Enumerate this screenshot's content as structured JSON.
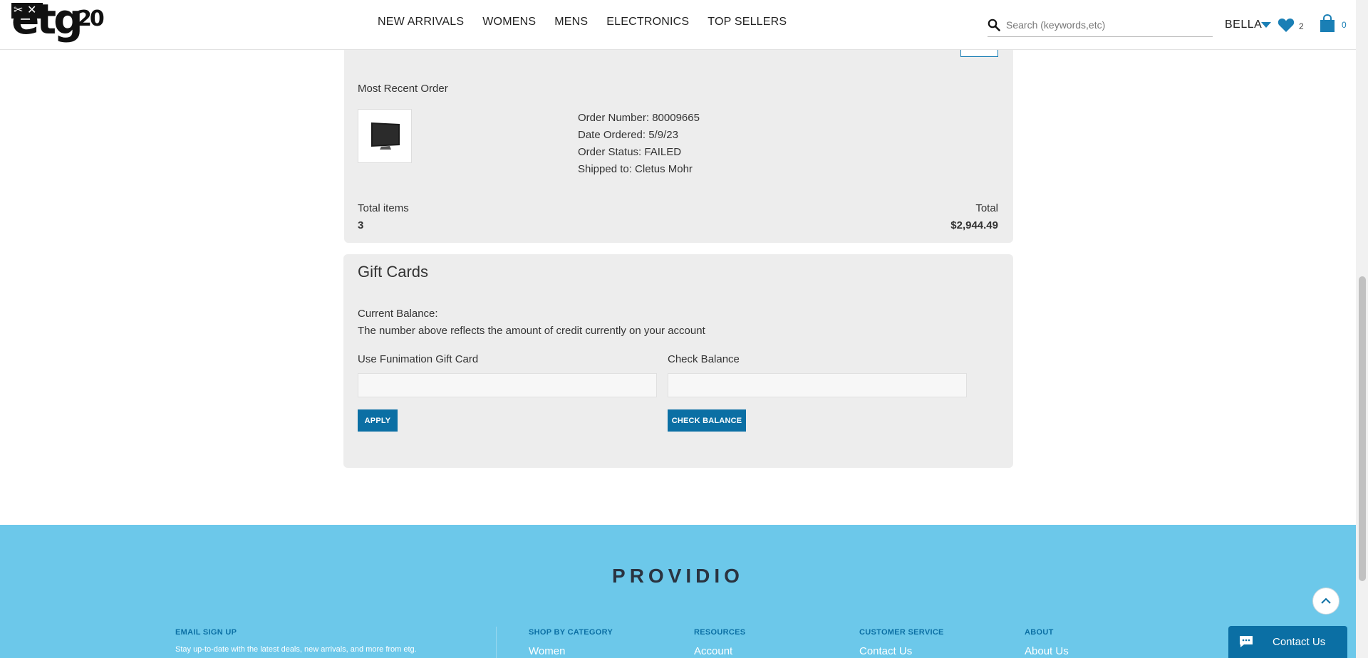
{
  "header": {
    "logo_text": "etg",
    "logo_badge": "20",
    "nav": [
      "NEW ARRIVALS",
      "WOMENS",
      "MENS",
      "ELECTRONICS",
      "TOP SELLERS"
    ],
    "search_placeholder": "Search (keywords,etc)",
    "user_name": "BELLA",
    "wishlist_count": "2",
    "cart_count": "0"
  },
  "order": {
    "most_recent_label": "Most Recent Order",
    "order_number": "Order Number: 80009665",
    "date_ordered": "Date Ordered: 5/9/23",
    "order_status": "Order Status: FAILED",
    "shipped_to": "Shipped to: Cletus Mohr",
    "total_items_label": "Total items",
    "total_items_value": "3",
    "total_label": "Total",
    "total_value": "$2,944.49"
  },
  "gift_cards": {
    "title": "Gift Cards",
    "current_balance_label": "Current Balance:",
    "balance_description": "The number above reflects the amount of credit currently on your account",
    "use_label": "Use Funimation Gift Card",
    "check_label": "Check Balance",
    "apply_button": "APPLY",
    "check_button": "CHECK BALANCE"
  },
  "footer": {
    "brand": "PROVIDIO",
    "email_signup_head": "EMAIL SIGN UP",
    "email_signup_text": "Stay up-to-date with the latest deals, new arrivals, and more from etg.",
    "columns": [
      {
        "head": "SHOP BY CATEGORY",
        "link": "Women"
      },
      {
        "head": "RESOURCES",
        "link": "Account"
      },
      {
        "head": "CUSTOMER SERVICE",
        "link": "Contact Us"
      },
      {
        "head": "ABOUT",
        "link": "About Us"
      }
    ],
    "contact_button": "Contact Us"
  },
  "colors": {
    "accent": "#0b6fa4",
    "footer_bg": "#6cc8ea",
    "panel_bg": "#ededed"
  }
}
